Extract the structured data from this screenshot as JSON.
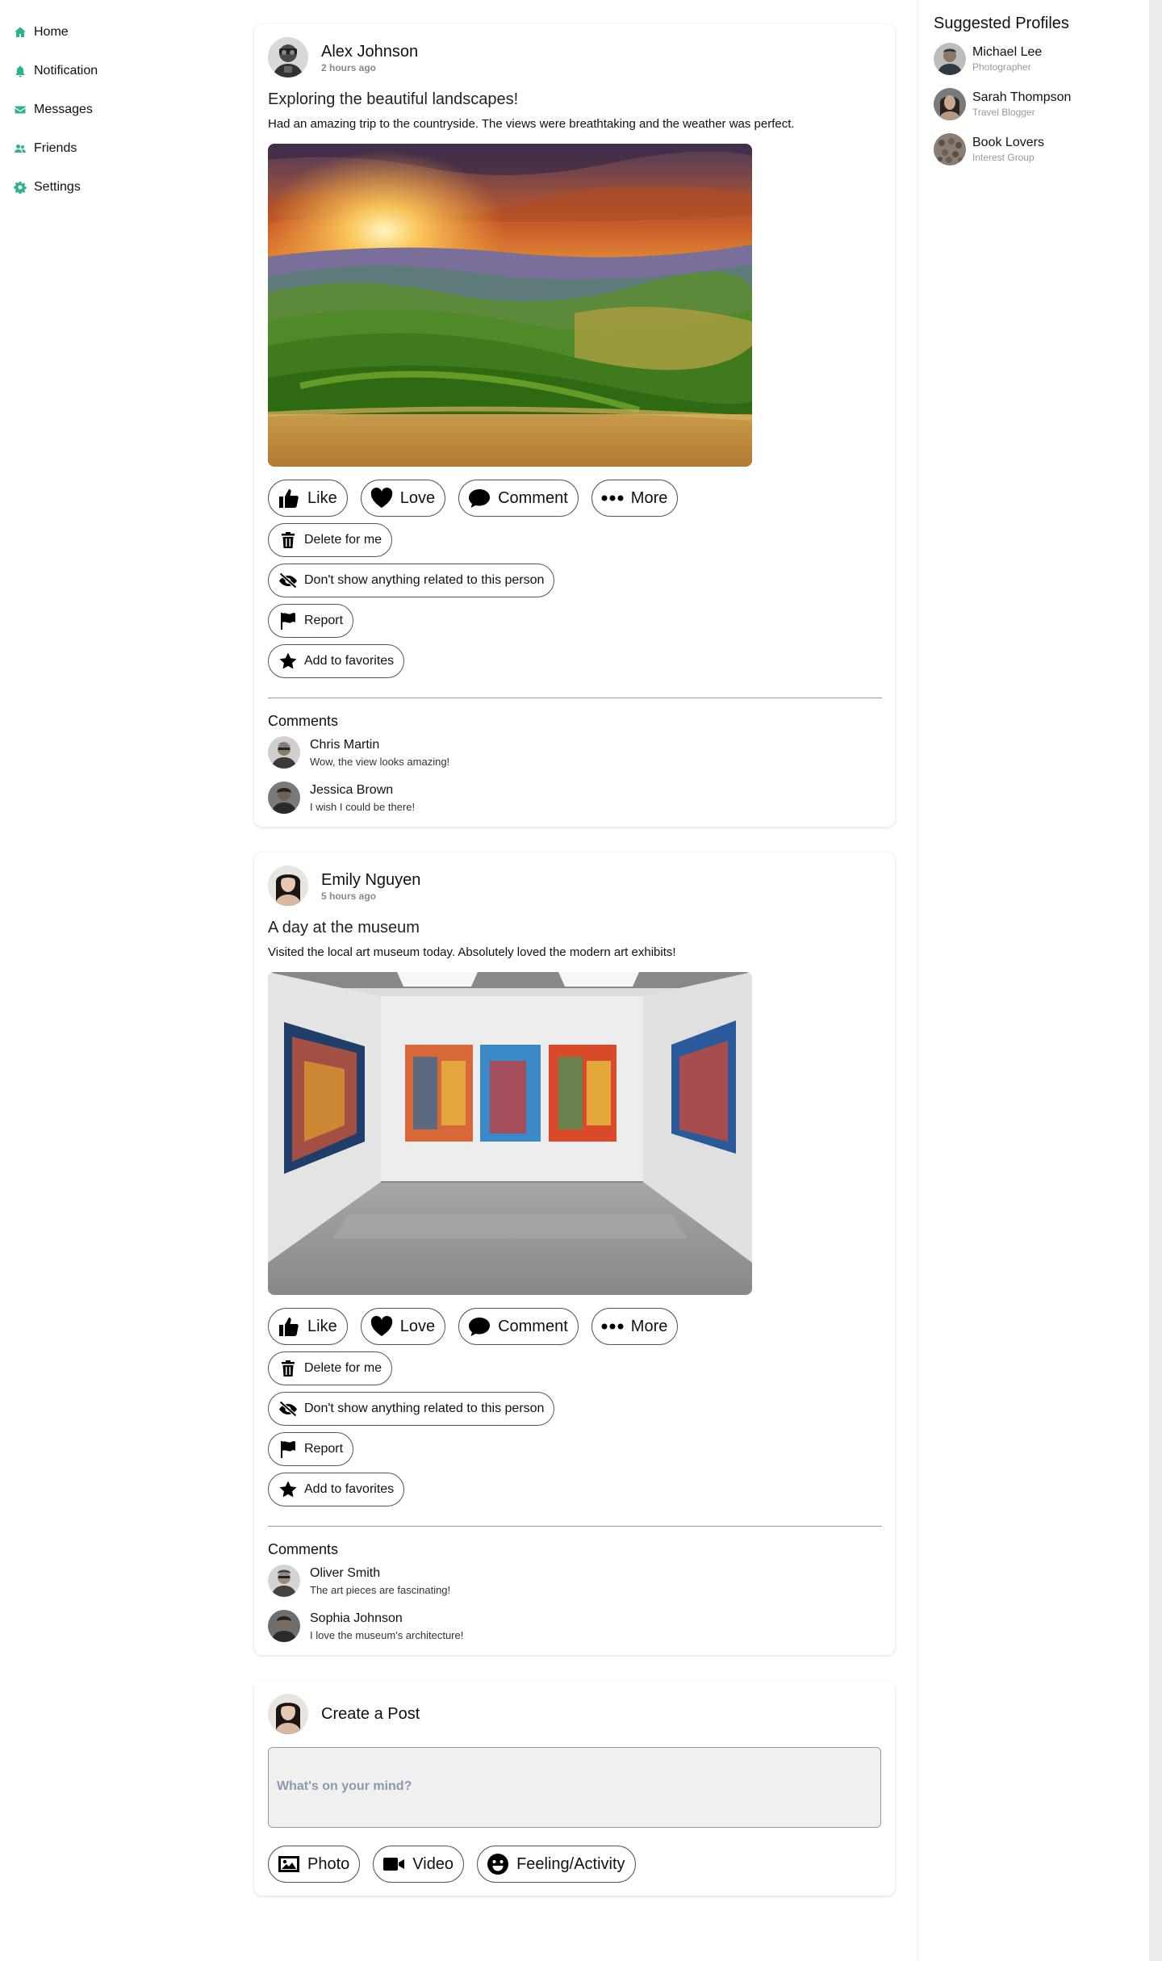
{
  "sidebar": {
    "items": [
      {
        "label": "Home",
        "icon": "home-icon"
      },
      {
        "label": "Notification",
        "icon": "bell-icon"
      },
      {
        "label": "Messages",
        "icon": "envelope-icon"
      },
      {
        "label": "Friends",
        "icon": "users-icon"
      },
      {
        "label": "Settings",
        "icon": "gear-icon"
      }
    ],
    "accent_color": "#2bb38a"
  },
  "actions": {
    "like": "Like",
    "love": "Love",
    "comment": "Comment",
    "more": "More",
    "delete": "Delete for me",
    "hide": "Don't show anything related to this person",
    "report": "Report",
    "favorite": "Add to favorites",
    "comments_heading": "Comments"
  },
  "posts": [
    {
      "author": "Alex Johnson",
      "time": "2 hours ago",
      "title": "Exploring the beautiful landscapes!",
      "body": "Had an amazing trip to the countryside. The views were breathtaking and the weather was perfect.",
      "image": "sunset-rolling-hills-image",
      "comments": [
        {
          "name": "Chris Martin",
          "text": "Wow, the view looks amazing!"
        },
        {
          "name": "Jessica Brown",
          "text": "I wish I could be there!"
        }
      ]
    },
    {
      "author": "Emily Nguyen",
      "time": "5 hours ago",
      "title": "A day at the museum",
      "body": "Visited the local art museum today. Absolutely loved the modern art exhibits!",
      "image": "art-gallery-image",
      "comments": [
        {
          "name": "Oliver Smith",
          "text": "The art pieces are fascinating!"
        },
        {
          "name": "Sophia Johnson",
          "text": "I love the museum's architecture!"
        }
      ]
    }
  ],
  "create_post": {
    "title": "Create a Post",
    "placeholder": "What's on your mind?",
    "photo": "Photo",
    "video": "Video",
    "feeling": "Feeling/Activity"
  },
  "suggested": {
    "title": "Suggested Profiles",
    "profiles": [
      {
        "name": "Michael Lee",
        "sub": "Photographer"
      },
      {
        "name": "Sarah Thompson",
        "sub": "Travel Blogger"
      },
      {
        "name": "Book Lovers",
        "sub": "Interest Group"
      }
    ]
  }
}
